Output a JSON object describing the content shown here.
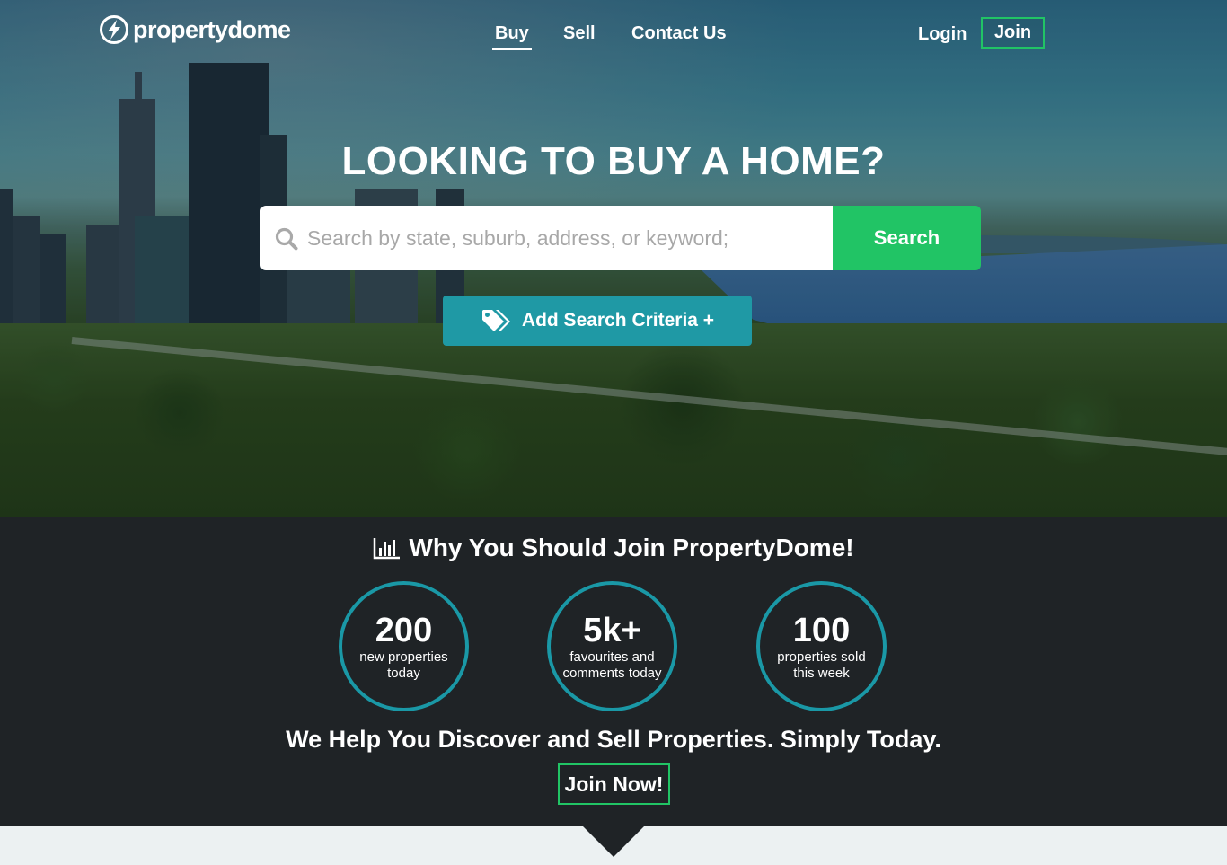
{
  "brand": {
    "name": "propertydome"
  },
  "nav": {
    "items": [
      {
        "label": "Buy",
        "active": true
      },
      {
        "label": "Sell",
        "active": false
      },
      {
        "label": "Contact Us",
        "active": false
      }
    ],
    "login": "Login",
    "join": "Join"
  },
  "hero": {
    "title": "LOOKING TO BUY A HOME?",
    "search": {
      "placeholder": "Search by state, suburb, address, or keyword;",
      "value": "",
      "button": "Search"
    },
    "criteria_button": "Add Search Criteria +"
  },
  "why": {
    "title": "Why You Should Join PropertyDome!",
    "stats": [
      {
        "value": "200",
        "label": "new properties today"
      },
      {
        "value": "5k+",
        "label": "favourites and comments today"
      },
      {
        "value": "100",
        "label": "properties sold this week"
      }
    ],
    "tagline": "We Help You Discover and Sell Properties. Simply Today.",
    "join_now": "Join Now!"
  },
  "colors": {
    "accent_green": "#21c465",
    "accent_teal": "#1f99a5",
    "dark_bg": "#1f2326",
    "light_bg": "#ecf1f2"
  },
  "icons": {
    "logo": "lightning-bolt-circle-icon",
    "search": "search-icon",
    "tags": "tags-icon",
    "chart": "bar-chart-icon",
    "down": "triangle-down-icon"
  }
}
